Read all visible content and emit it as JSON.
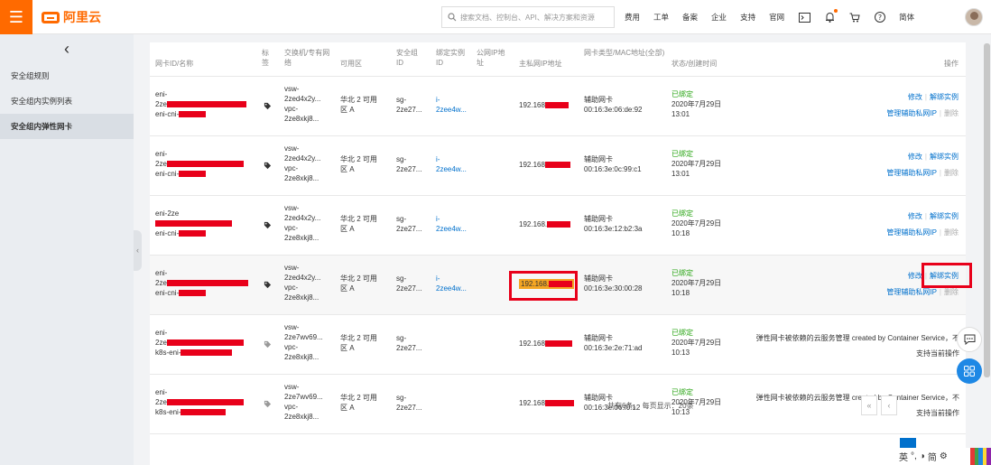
{
  "topbar": {
    "brand": "阿里云",
    "search_placeholder": "搜索文档、控制台、API、解决方案和资源",
    "nav": [
      "费用",
      "工单",
      "备案",
      "企业",
      "支持",
      "官网"
    ],
    "language": "简体"
  },
  "sidebar": {
    "back_icon": "chevron-left-icon",
    "items": [
      {
        "label": "安全组规则",
        "active": false
      },
      {
        "label": "安全组内实例列表",
        "active": false
      },
      {
        "label": "安全组内弹性网卡",
        "active": true
      }
    ]
  },
  "table": {
    "headers": {
      "nic": "网卡ID/名称",
      "tag": "标签",
      "vsw": "交换机/专有网络",
      "zone": "可用区",
      "sg": "安全组ID",
      "inst": "绑定实例ID",
      "pubip": "公网IP地址",
      "privip": "主私网IP地址",
      "mac": "网卡类型/MAC地址(全部)",
      "status": "状态/创建时间",
      "ops": "操作"
    },
    "rows": [
      {
        "nic1": "eni-",
        "nic2": "2ze",
        "nic3": "eni-cni-",
        "vsw1": "vsw-",
        "vsw2": "2zed4x2y...",
        "vpc1": "vpc-",
        "vpc2": "2ze8xkj8...",
        "zone": "华北 2 可用区 A",
        "sg1": "sg-",
        "sg2": "2ze27...",
        "inst1": "i-",
        "inst2": "2zee4w...",
        "ip": "192.168",
        "type": "辅助网卡",
        "mac": "00:16:3e:06:de:92",
        "status": "已绑定",
        "date": "2020年7月29日",
        "time": "13:01",
        "op_edit": "修改",
        "op_unbind": "解绑实例",
        "op_manage": "管理辅助私网IP",
        "op_delete": "删除"
      },
      {
        "nic1": "eni-",
        "nic2": "2ze",
        "nic3": "eni-cni-",
        "vsw1": "vsw-",
        "vsw2": "2zed4x2y...",
        "vpc1": "vpc-",
        "vpc2": "2ze8xkj8...",
        "zone": "华北 2 可用区 A",
        "sg1": "sg-",
        "sg2": "2ze27...",
        "inst1": "i-",
        "inst2": "2zee4w...",
        "ip": "192.168",
        "type": "辅助网卡",
        "mac": "00:16:3e:0c:99:c1",
        "status": "已绑定",
        "date": "2020年7月29日",
        "time": "13:01",
        "op_edit": "修改",
        "op_unbind": "解绑实例",
        "op_manage": "管理辅助私网IP",
        "op_delete": "删除"
      },
      {
        "nic1": "eni-2ze",
        "nic2": "",
        "nic3": "eni-cni-",
        "vsw1": "vsw-",
        "vsw2": "2zed4x2y...",
        "vpc1": "vpc-",
        "vpc2": "2ze8xkj8...",
        "zone": "华北 2 可用区 A",
        "sg1": "sg-",
        "sg2": "2ze27...",
        "inst1": "i-",
        "inst2": "2zee4w...",
        "ip": "192.168.",
        "type": "辅助网卡",
        "mac": "00:16:3e:12:b2:3a",
        "status": "已绑定",
        "date": "2020年7月29日",
        "time": "10:18",
        "op_edit": "修改",
        "op_unbind": "解绑实例",
        "op_manage": "管理辅助私网IP",
        "op_delete": "删除"
      },
      {
        "nic1": "eni-",
        "nic2": "2ze",
        "nic3": "eni-cni-",
        "vsw1": "vsw-",
        "vsw2": "2zed4x2y...",
        "vpc1": "vpc-",
        "vpc2": "2ze8xkj8...",
        "zone": "华北 2 可用区 A",
        "sg1": "sg-",
        "sg2": "2ze27...",
        "inst1": "i-",
        "inst2": "2zee4w...",
        "ip": "192.168.",
        "type": "辅助网卡",
        "mac": "00:16:3e:30:00:28",
        "status": "已绑定",
        "date": "2020年7月29日",
        "time": "10:18",
        "op_edit": "修改",
        "op_unbind": "解绑实例",
        "op_manage": "管理辅助私网IP",
        "op_delete": "删除"
      },
      {
        "nic1": "eni-",
        "nic2": "2ze",
        "nic3": "k8s-eni-",
        "vsw1": "vsw-",
        "vsw2": "2ze7wv69...",
        "vpc1": "vpc-",
        "vpc2": "2ze8xkj8...",
        "zone": "华北 2 可用区 A",
        "sg1": "sg-",
        "sg2": "2ze27...",
        "inst1": "",
        "inst2": "",
        "ip": "192.168",
        "type": "辅助网卡",
        "mac": "00:16:3e:2e:71:ad",
        "status": "已绑定",
        "date": "2020年7月29日",
        "time": "10:13",
        "note1": "弹性网卡被依赖的云服务管理 created by Container Service，不",
        "note2": "支持当前操作"
      },
      {
        "nic1": "eni-",
        "nic2": "2ze",
        "nic3": "k8s-eni-",
        "vsw1": "vsw-",
        "vsw2": "2ze7wv69...",
        "vpc1": "vpc-",
        "vpc2": "2ze8xkj8...",
        "zone": "华北 2 可用区 A",
        "sg1": "sg-",
        "sg2": "2ze27...",
        "inst1": "",
        "inst2": "",
        "ip": "192.168",
        "type": "辅助网卡",
        "mac": "00:16:3e:06:f0:12",
        "status": "已绑定",
        "date": "2020年7月29日",
        "time": "10:13",
        "note1": "弹性网卡被依赖的云服务管理 created by Container Service，不",
        "note2": "支持当前操作"
      }
    ]
  },
  "pager": {
    "summary": "共有6条。 每页显示：20条"
  },
  "ime": {
    "lang": "英",
    "mode": "简"
  }
}
